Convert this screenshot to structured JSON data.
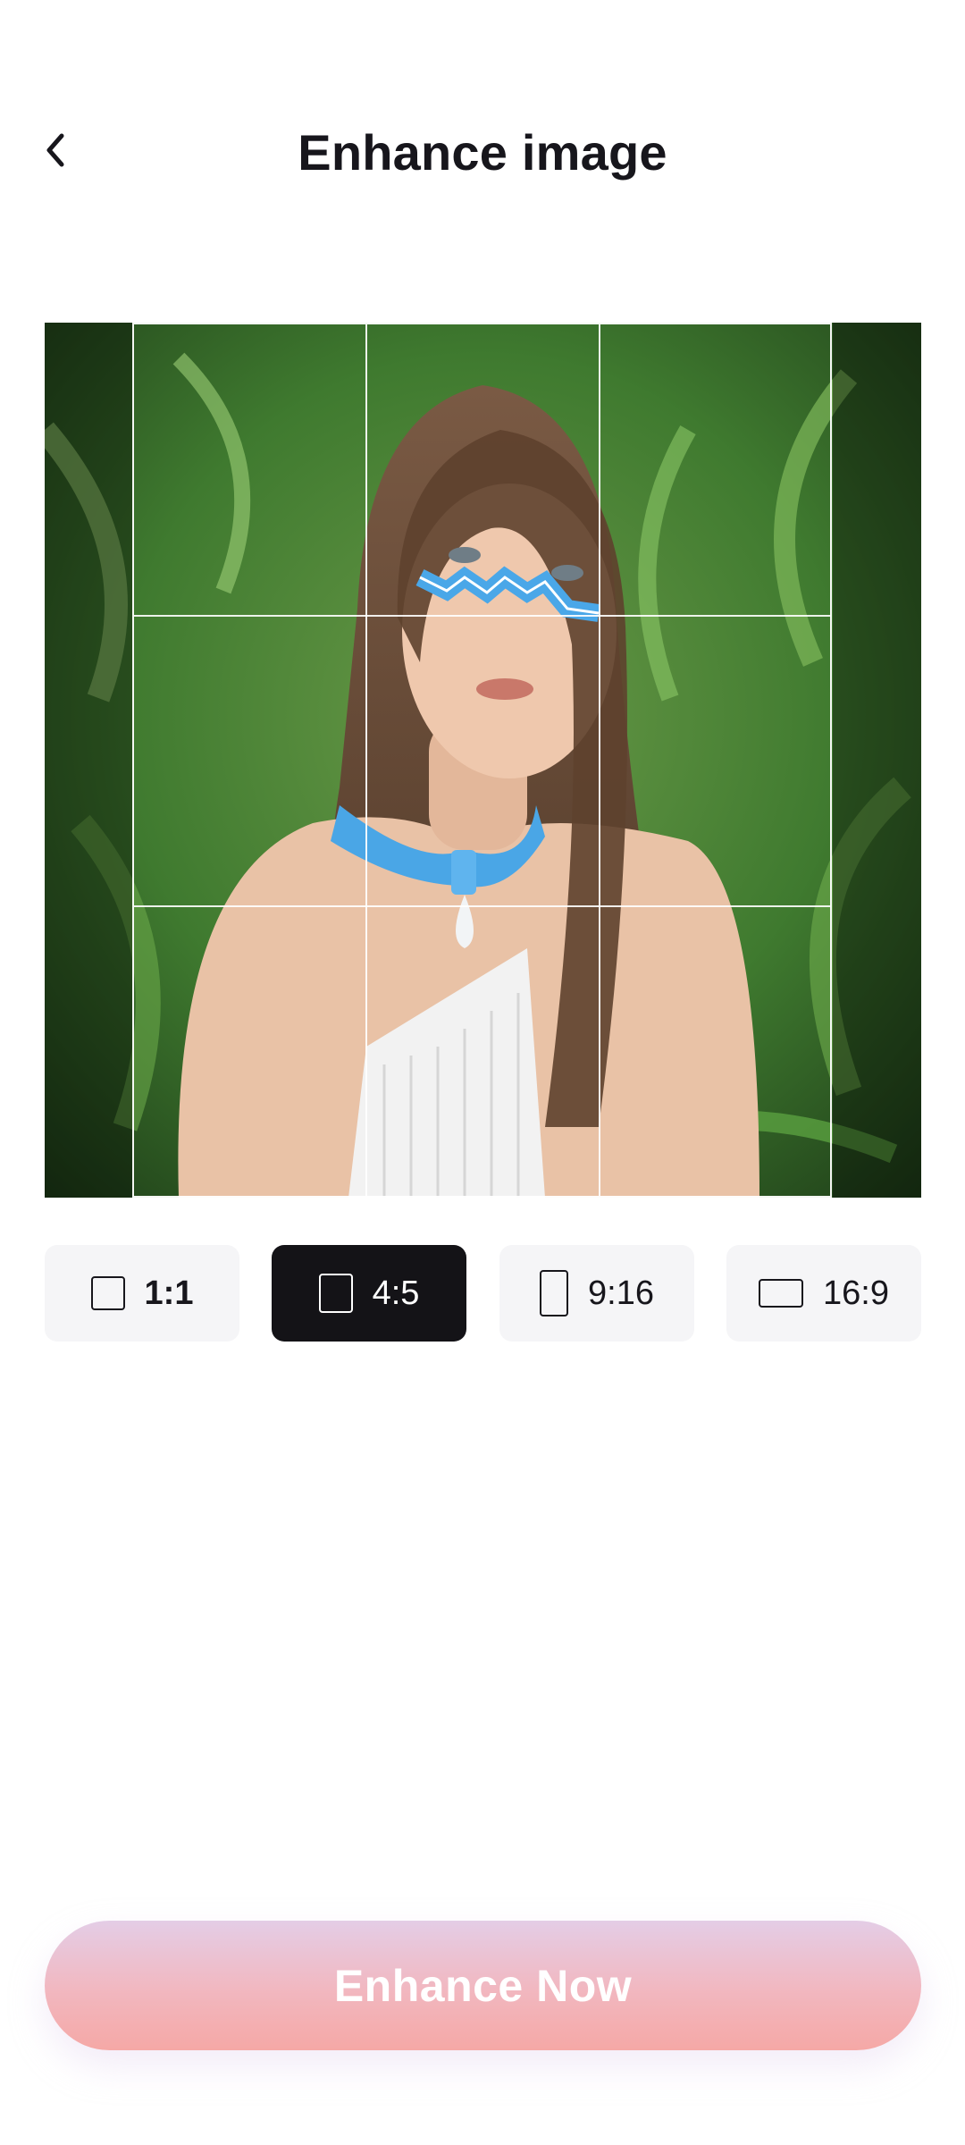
{
  "header": {
    "title": "Enhance image",
    "back_icon": "chevron-left-icon"
  },
  "editor": {
    "selected_ratio": "4:5",
    "grid": "3x3"
  },
  "ratios": [
    {
      "label": "1:1",
      "icon": "square-icon",
      "active": false
    },
    {
      "label": "4:5",
      "icon": "portrait-rect-icon",
      "active": true
    },
    {
      "label": "9:16",
      "icon": "tall-rect-icon",
      "active": false
    },
    {
      "label": "16:9",
      "icon": "wide-rect-icon",
      "active": false
    }
  ],
  "cta": {
    "label": "Enhance Now"
  },
  "colors": {
    "active_chip": "#141317",
    "chip_bg": "#f5f5f7",
    "cta_top": "#e4cde6",
    "cta_bottom": "#f5a8a6"
  }
}
